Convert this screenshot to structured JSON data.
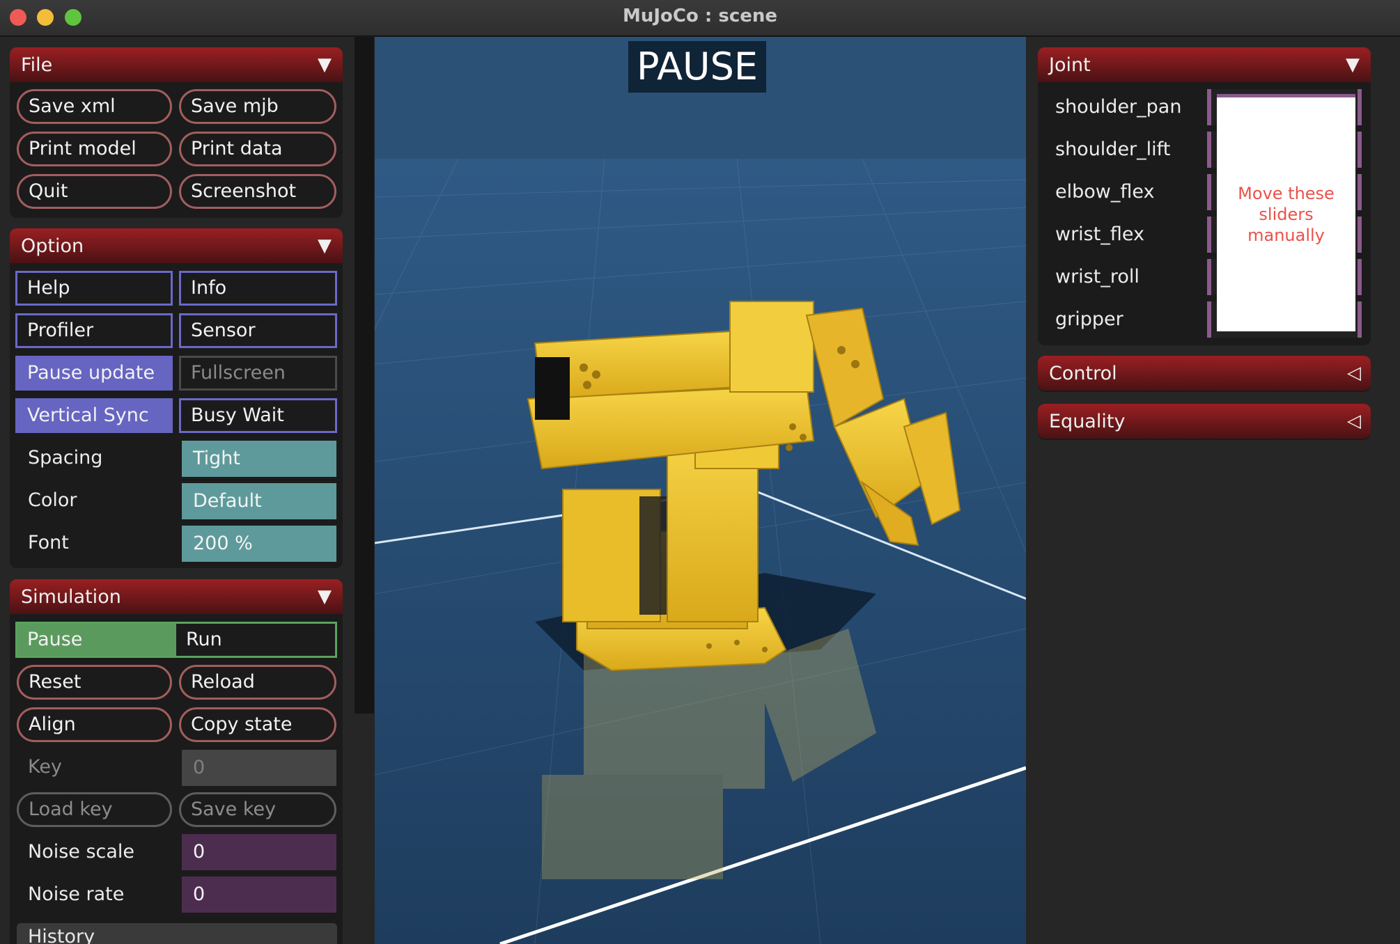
{
  "window": {
    "title": "MuJoCo : scene"
  },
  "file": {
    "title": "File",
    "buttons": [
      "Save xml",
      "Save mjb",
      "Print model",
      "Print data",
      "Quit",
      "Screenshot"
    ]
  },
  "option": {
    "title": "Option",
    "checks": [
      {
        "label": "Help",
        "on": false
      },
      {
        "label": "Info",
        "on": false
      },
      {
        "label": "Profiler",
        "on": false
      },
      {
        "label": "Sensor",
        "on": false
      },
      {
        "label": "Pause update",
        "on": true
      },
      {
        "label": "Fullscreen",
        "on": false,
        "disabled": true
      },
      {
        "label": "Vertical Sync",
        "on": true
      },
      {
        "label": "Busy Wait",
        "on": false
      }
    ],
    "spacing_label": "Spacing",
    "spacing_value": "Tight",
    "color_label": "Color",
    "color_value": "Default",
    "font_label": "Font",
    "font_value": "200 %"
  },
  "simulation": {
    "title": "Simulation",
    "pause_label": "Pause",
    "run_label": "Run",
    "reset": "Reset",
    "reload": "Reload",
    "align": "Align",
    "copy_state": "Copy state",
    "key_label": "Key",
    "key_value": "0",
    "load_key": "Load key",
    "save_key": "Save key",
    "noise_scale_label": "Noise scale",
    "noise_scale_value": "0",
    "noise_rate_label": "Noise rate",
    "noise_rate_value": "0",
    "history_label": "History"
  },
  "viewport": {
    "status": "PAUSE"
  },
  "joint": {
    "title": "Joint",
    "names": [
      "shoulder_pan",
      "shoulder_lift",
      "elbow_flex",
      "wrist_flex",
      "wrist_roll",
      "gripper"
    ],
    "note": "Move these sliders manually"
  },
  "control": {
    "title": "Control"
  },
  "equality": {
    "title": "Equality"
  },
  "colors": {
    "accent": "#9a1f22",
    "check": "#6665c2",
    "select": "#5e9a9b",
    "edit": "#4c2d4f",
    "radio": "#5b9a5d",
    "robot": "#f2c230"
  }
}
